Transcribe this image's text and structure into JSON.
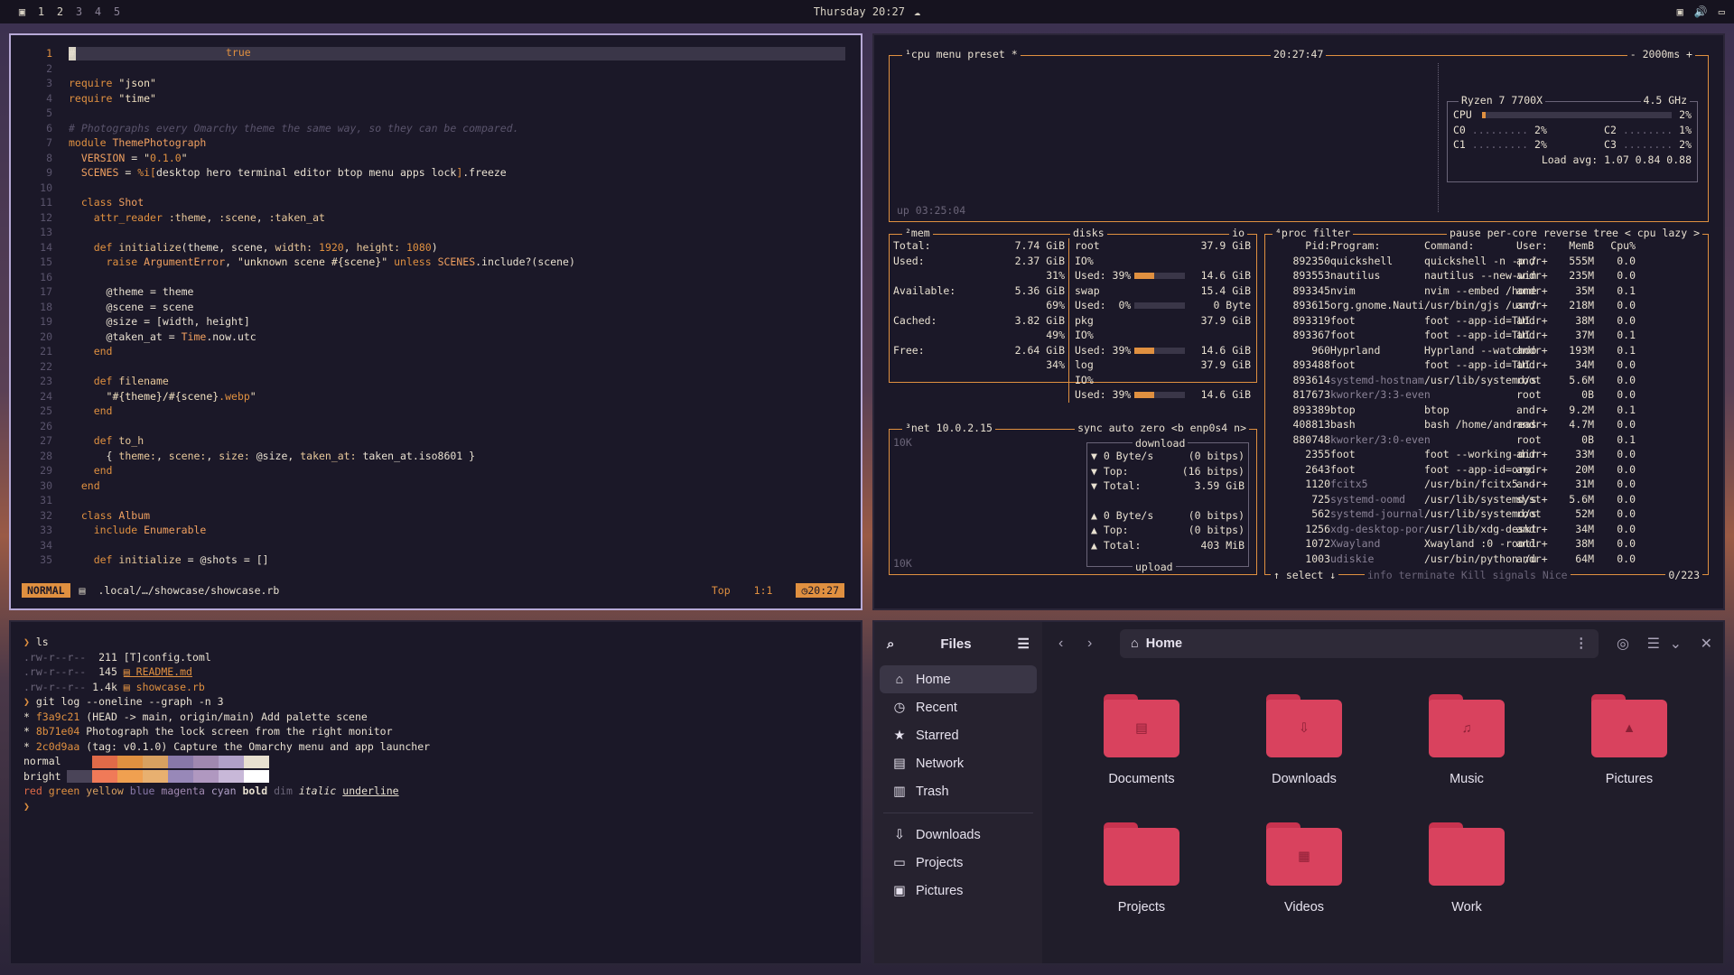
{
  "topbar": {
    "ws": [
      "1",
      "2",
      "3",
      "4",
      "5"
    ],
    "clock": "Thursday 20:27"
  },
  "editor": {
    "lines": [
      "1",
      "2",
      "3",
      "4",
      "5",
      "6",
      "7",
      "8",
      "9",
      "10",
      "11",
      "12",
      "13",
      "14",
      "15",
      "16",
      "17",
      "18",
      "19",
      "20",
      "21",
      "22",
      "23",
      "24",
      "25",
      "26",
      "27",
      "28",
      "29",
      "30",
      "31",
      "32",
      "33",
      "34",
      "35"
    ],
    "virtual": "true",
    "mode": "NORMAL",
    "path": ".local/…/showcase/showcase.rb",
    "pos": "Top",
    "cursor": "1:1",
    "time": "20:27"
  },
  "btop": {
    "cpu_title": "¹cpu",
    "cpu_menu": "menu",
    "cpu_preset": "preset *",
    "cpu_clock": "20:27:47",
    "cpu_rate": "- 2000ms +",
    "cpu_model": "Ryzen 7 7700X",
    "cpu_ghz": "4.5 GHz",
    "cpu_total": "2%",
    "c0": "2%",
    "c1": "2%",
    "c2": "1%",
    "c3": "2%",
    "load": "Load avg: 1.07 0.84 0.88",
    "uptime": "up 03:25:04",
    "mem_title": "²mem",
    "disks_title": "disks",
    "io_title": "io",
    "net_title": "³net",
    "net_ip": "10.0.2.15",
    "net_opts": "sync auto zero <b enp0s4 n>",
    "proc_title": "⁴proc",
    "proc_filter": "filter",
    "proc_opts": "pause per-core reverse tree < cpu lazy >",
    "proc_footer": "↑ select ↓",
    "proc_footer2": "info terminate Kill signals Nice",
    "proc_count": "0/223"
  },
  "processes": [
    [
      "892350",
      "quickshell",
      "quickshell -n -p /",
      "andr+",
      "555M",
      "0.0"
    ],
    [
      "893553",
      "nautilus",
      "nautilus --new-win",
      "andr+",
      "235M",
      "0.0"
    ],
    [
      "893345",
      "nvim",
      "nvim --embed /home",
      "andr+",
      "35M",
      "0.1"
    ],
    [
      "893615",
      "org.gnome.Nauti",
      "/usr/bin/gjs /usr/",
      "andr+",
      "218M",
      "0.0"
    ],
    [
      "893319",
      "foot",
      "foot --app-id=TUI.",
      "andr+",
      "38M",
      "0.0"
    ],
    [
      "893367",
      "foot",
      "foot --app-id=TUI.",
      "andr+",
      "37M",
      "0.1"
    ],
    [
      "960",
      "Hyprland",
      "Hyprland --watchdo",
      "andr+",
      "193M",
      "0.1"
    ],
    [
      "893488",
      "foot",
      "foot --app-id=TUI.",
      "andr+",
      "34M",
      "0.0"
    ],
    [
      "893614",
      "systemd-hostnam",
      "/usr/lib/systemd/s",
      "root",
      "5.6M",
      "0.0"
    ],
    [
      "817673",
      "kworker/3:3-even",
      "",
      "root",
      "0B",
      "0.0"
    ],
    [
      "893389",
      "btop",
      "btop",
      "andr+",
      "9.2M",
      "0.1"
    ],
    [
      "408813",
      "bash",
      "bash /home/andreas",
      "andr+",
      "4.7M",
      "0.0"
    ],
    [
      "880748",
      "kworker/3:0-even",
      "",
      "root",
      "0B",
      "0.1"
    ],
    [
      "2355",
      "foot",
      "foot --working-dir",
      "andr+",
      "33M",
      "0.0"
    ],
    [
      "2643",
      "foot",
      "foot --app-id=org.",
      "andr+",
      "20M",
      "0.0"
    ],
    [
      "1120",
      "fcitx5",
      "/usr/bin/fcitx5 --",
      "andr+",
      "31M",
      "0.0"
    ],
    [
      "725",
      "systemd-oomd",
      "/usr/lib/systemd/s",
      "syst+",
      "5.6M",
      "0.0"
    ],
    [
      "562",
      "systemd-journal",
      "/usr/lib/systemd/s",
      "root",
      "52M",
      "0.0"
    ],
    [
      "1256",
      "xdg-desktop-por",
      "/usr/lib/xdg-deskt",
      "andr+",
      "34M",
      "0.0"
    ],
    [
      "1072",
      "Xwayland",
      "Xwayland :0 -rootl",
      "andr+",
      "38M",
      "0.0"
    ],
    [
      "1003",
      "udiskie",
      "/usr/bin/python /u",
      "andr+",
      "64M",
      "0.0"
    ]
  ],
  "proc_header": [
    "Pid:",
    "Program:",
    "Command:",
    "User:",
    "MemB",
    "Cpu%"
  ],
  "mem": {
    "total": "7.74 GiB",
    "used": "2.37 GiB",
    "used_pct": "31%",
    "avail": "5.36 GiB",
    "avail_pct": "69%",
    "cached": "3.82 GiB",
    "cached_pct": "49%",
    "free": "2.64 GiB",
    "free_pct": "34%"
  },
  "disks": {
    "root": "37.9 GiB",
    "root_used": "Used: 39%",
    "root_size": "14.6 GiB",
    "swap": "15.4 GiB",
    "swap_used": "Used:  0%",
    "swap_size": "0 Byte",
    "pkg": "37.9 GiB",
    "pkg_used": "Used: 39%",
    "pkg_size": "14.6 GiB",
    "log": "37.9 GiB",
    "log_used": "Used: 39%",
    "log_size": "14.6 GiB"
  },
  "net": {
    "scale": "10K",
    "download": "download",
    "dl_rate": "0 Byte/s",
    "dl_bits": "(0 bitps)",
    "dl_top": "Top:",
    "dl_top_v": "(16 bitps)",
    "dl_total": "Total:",
    "dl_total_v": "3.59 GiB",
    "ul_rate": "0 Byte/s",
    "ul_bits": "(0 bitps)",
    "ul_top_v": "(0 bitps)",
    "ul_total_v": "403 MiB",
    "upload": "upload"
  },
  "files": {
    "title": "Files",
    "location": "Home",
    "sidebar": [
      "Home",
      "Recent",
      "Starred",
      "Network",
      "Trash",
      "Downloads",
      "Projects",
      "Pictures"
    ],
    "folders": [
      "Documents",
      "Downloads",
      "Music",
      "Pictures",
      "Projects",
      "Videos",
      "Work"
    ]
  },
  "colors": {
    "accent": "#e09040",
    "folder": "#d9425e",
    "border_active": "#b7a9d6"
  }
}
